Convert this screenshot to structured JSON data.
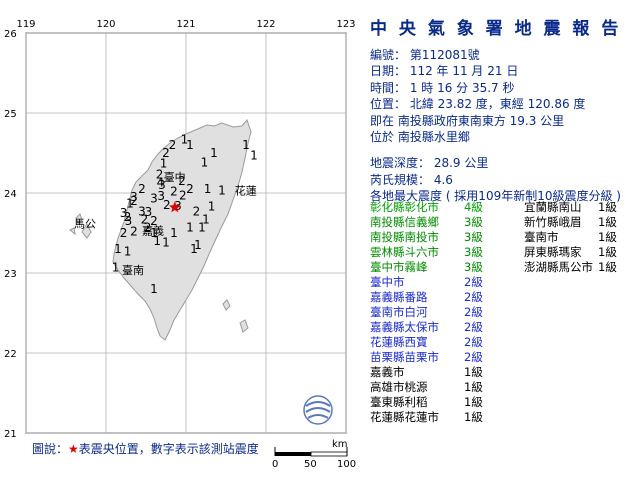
{
  "report": {
    "title": "中 央 氣 象 署 地 震 報 告",
    "lines": [
      "編號： 第112081號",
      "日期： 112 年 11 月 21 日",
      "時間： 1 時 16 分 35.7 秒",
      "位置： 北緯 23.82 度，東經 120.86 度",
      "即在 南投縣政府東南東方 19.3 公里",
      "位於 南投縣水里鄉",
      "地震深度： 28.9 公里",
      "芮氏規模： 4.6",
      "各地最大震度 ( 採用109年新制10級震度分級 )"
    ]
  },
  "intensity_left": [
    {
      "name": "彰化縣彰化市",
      "level": "4級",
      "color": "#00a000"
    },
    {
      "name": "南投縣信義鄉",
      "level": "3級",
      "color": "#008c00"
    },
    {
      "name": "南投縣南投市",
      "level": "3級",
      "color": "#008c00"
    },
    {
      "name": "雲林縣斗六市",
      "level": "3級",
      "color": "#008c00"
    },
    {
      "name": "臺中市霧峰",
      "level": "3級",
      "color": "#008c00"
    },
    {
      "name": "臺中市",
      "level": "2級",
      "color": "#1a2acc"
    },
    {
      "name": "嘉義縣番路",
      "level": "2級",
      "color": "#1a2acc"
    },
    {
      "name": "臺南市白河",
      "level": "2級",
      "color": "#1a2acc"
    },
    {
      "name": "嘉義縣太保市",
      "level": "2級",
      "color": "#1a2acc"
    },
    {
      "name": "花蓮縣西寶",
      "level": "2級",
      "color": "#1a2acc"
    },
    {
      "name": "苗栗縣苗栗市",
      "level": "2級",
      "color": "#1a2acc"
    },
    {
      "name": "嘉義市",
      "level": "1級",
      "color": "#000000"
    },
    {
      "name": "高雄市桃源",
      "level": "1級",
      "color": "#000000"
    },
    {
      "name": "臺東縣利稻",
      "level": "1級",
      "color": "#000000"
    },
    {
      "name": "花蓮縣花蓮市",
      "level": "1級",
      "color": "#000000"
    }
  ],
  "intensity_right": [
    {
      "name": "宜蘭縣南山",
      "level": "1級",
      "color": "#000000"
    },
    {
      "name": "新竹縣峨眉",
      "level": "1級",
      "color": "#000000"
    },
    {
      "name": "臺南市",
      "level": "1級",
      "color": "#000000"
    },
    {
      "name": "屏東縣瑪家",
      "level": "1級",
      "color": "#000000"
    },
    {
      "name": "澎湖縣馬公市",
      "level": "1級",
      "color": "#000000"
    }
  ],
  "map": {
    "lon_labels": [
      "119",
      "120",
      "121",
      "122",
      "123"
    ],
    "lat_labels": [
      "26",
      "25",
      "24",
      "23",
      "22",
      "21"
    ],
    "lon_range": [
      119,
      123
    ],
    "lat_range": [
      21,
      26
    ],
    "epicenter": {
      "lon": 120.86,
      "lat": 23.82
    },
    "land_color": "#e0e0e0",
    "sea_color": "#ffffff",
    "city_labels": [
      {
        "name": "臺中",
        "lon": 120.72,
        "lat": 24.15
      },
      {
        "name": "花蓮",
        "lon": 121.61,
        "lat": 23.98
      },
      {
        "name": "馬公",
        "lon": 119.6,
        "lat": 23.57
      },
      {
        "name": "嘉義",
        "lon": 120.45,
        "lat": 23.48
      },
      {
        "name": "臺南",
        "lon": 120.2,
        "lat": 22.99
      }
    ],
    "stations": [
      {
        "lon": 120.68,
        "lat": 24.08,
        "value": "4",
        "color": "#00a000"
      },
      {
        "lon": 120.9,
        "lat": 23.79,
        "value": "3",
        "color": "#008c00"
      },
      {
        "lon": 120.69,
        "lat": 23.91,
        "value": "3",
        "color": "#008c00"
      },
      {
        "lon": 120.53,
        "lat": 23.71,
        "value": "3",
        "color": "#008c00"
      },
      {
        "lon": 120.7,
        "lat": 24.05,
        "value": "3",
        "color": "#008c00"
      },
      {
        "lon": 120.35,
        "lat": 23.9,
        "value": "3",
        "color": "#008c00"
      },
      {
        "lon": 120.45,
        "lat": 23.72,
        "value": "3",
        "color": "#008c00"
      },
      {
        "lon": 120.22,
        "lat": 23.7,
        "value": "3",
        "color": "#008c00"
      },
      {
        "lon": 120.28,
        "lat": 23.6,
        "value": "3",
        "color": "#008c00"
      },
      {
        "lon": 120.6,
        "lat": 23.88,
        "value": "3",
        "color": "#008c00"
      },
      {
        "lon": 120.83,
        "lat": 24.55,
        "value": "2",
        "color": "#1a2acc"
      },
      {
        "lon": 120.75,
        "lat": 24.45,
        "value": "2",
        "color": "#1a2acc"
      },
      {
        "lon": 120.67,
        "lat": 24.18,
        "value": "2",
        "color": "#1a2acc"
      },
      {
        "lon": 120.95,
        "lat": 24.1,
        "value": "2",
        "color": "#1a2acc"
      },
      {
        "lon": 121.05,
        "lat": 24.0,
        "value": "2",
        "color": "#1a2acc"
      },
      {
        "lon": 120.85,
        "lat": 23.97,
        "value": "2",
        "color": "#1a2acc"
      },
      {
        "lon": 120.76,
        "lat": 23.8,
        "value": "2",
        "color": "#1a2acc"
      },
      {
        "lon": 120.45,
        "lat": 24.0,
        "value": "2",
        "color": "#1a2acc"
      },
      {
        "lon": 120.35,
        "lat": 23.85,
        "value": "2",
        "color": "#1a2acc"
      },
      {
        "lon": 120.27,
        "lat": 23.65,
        "value": "2",
        "color": "#1a2acc"
      },
      {
        "lon": 120.35,
        "lat": 23.47,
        "value": "2",
        "color": "#1a2acc"
      },
      {
        "lon": 120.22,
        "lat": 23.45,
        "value": "2",
        "color": "#1a2acc"
      },
      {
        "lon": 120.6,
        "lat": 23.6,
        "value": "2",
        "color": "#1a2acc"
      },
      {
        "lon": 121.13,
        "lat": 23.72,
        "value": "2",
        "color": "#1a2acc"
      },
      {
        "lon": 120.96,
        "lat": 23.92,
        "value": "2",
        "color": "#1a2acc"
      },
      {
        "lon": 120.52,
        "lat": 23.52,
        "value": "2",
        "color": "#1a2acc"
      },
      {
        "lon": 120.48,
        "lat": 23.62,
        "value": "2",
        "color": "#1a2acc"
      },
      {
        "lon": 120.98,
        "lat": 24.62,
        "value": "1",
        "color": "#000000"
      },
      {
        "lon": 121.05,
        "lat": 24.55,
        "value": "1",
        "color": "#000000"
      },
      {
        "lon": 121.35,
        "lat": 24.45,
        "value": "1",
        "color": "#000000"
      },
      {
        "lon": 121.75,
        "lat": 24.55,
        "value": "1",
        "color": "#000000"
      },
      {
        "lon": 121.85,
        "lat": 24.42,
        "value": "1",
        "color": "#000000"
      },
      {
        "lon": 120.72,
        "lat": 24.32,
        "value": "1",
        "color": "#000000"
      },
      {
        "lon": 121.23,
        "lat": 24.33,
        "value": "1",
        "color": "#000000"
      },
      {
        "lon": 121.27,
        "lat": 24.0,
        "value": "1",
        "color": "#000000"
      },
      {
        "lon": 121.45,
        "lat": 23.98,
        "value": "1",
        "color": "#000000"
      },
      {
        "lon": 121.32,
        "lat": 23.78,
        "value": "1",
        "color": "#000000"
      },
      {
        "lon": 121.25,
        "lat": 23.62,
        "value": "1",
        "color": "#000000"
      },
      {
        "lon": 121.2,
        "lat": 23.52,
        "value": "1",
        "color": "#000000"
      },
      {
        "lon": 121.05,
        "lat": 23.52,
        "value": "1",
        "color": "#000000"
      },
      {
        "lon": 120.85,
        "lat": 23.45,
        "value": "1",
        "color": "#000000"
      },
      {
        "lon": 120.75,
        "lat": 23.33,
        "value": "1",
        "color": "#000000"
      },
      {
        "lon": 120.64,
        "lat": 23.35,
        "value": "1",
        "color": "#000000"
      },
      {
        "lon": 120.15,
        "lat": 23.25,
        "value": "1",
        "color": "#000000"
      },
      {
        "lon": 120.27,
        "lat": 23.22,
        "value": "1",
        "color": "#000000"
      },
      {
        "lon": 120.12,
        "lat": 23.02,
        "value": "1",
        "color": "#000000"
      },
      {
        "lon": 120.6,
        "lat": 22.75,
        "value": "1",
        "color": "#000000"
      },
      {
        "lon": 121.15,
        "lat": 23.3,
        "value": "1",
        "color": "#000000"
      },
      {
        "lon": 121.1,
        "lat": 23.25,
        "value": "1",
        "color": "#000000"
      },
      {
        "lon": 120.3,
        "lat": 23.82,
        "value": "1",
        "color": "#000000"
      },
      {
        "lon": 120.6,
        "lat": 23.45,
        "value": "1",
        "color": "#000000"
      }
    ]
  },
  "scale": {
    "unit": "km",
    "labels": [
      "0",
      "50",
      "100"
    ]
  },
  "legend": {
    "prefix": "圖說：",
    "star": "★",
    "text": "表震央位置，數字表示該測站震度"
  }
}
